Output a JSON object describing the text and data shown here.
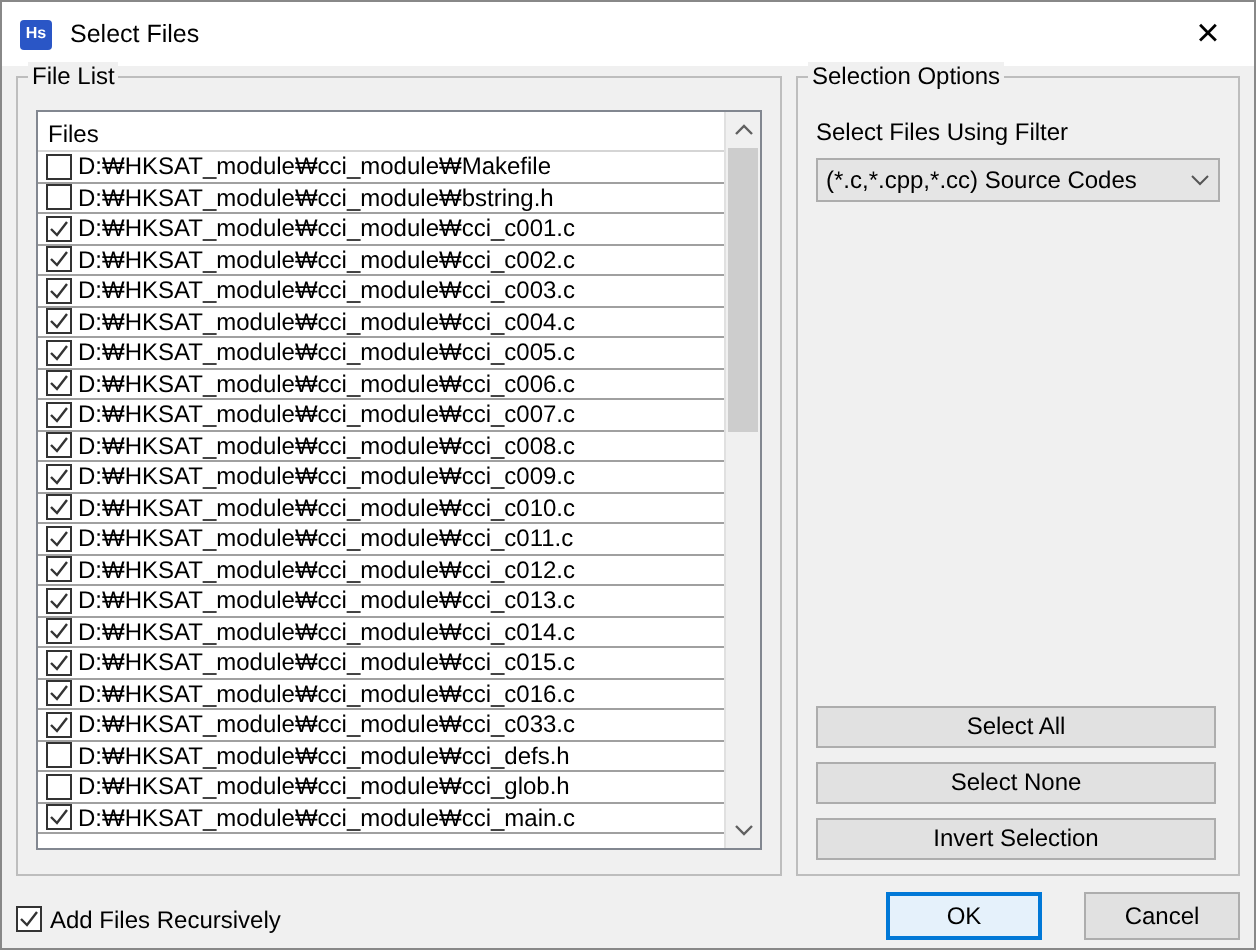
{
  "window": {
    "title": "Select Files",
    "icon_text": "Hs",
    "close": "×"
  },
  "file_list": {
    "title": "File List",
    "column": "Files",
    "rows": [
      {
        "path": "D:₩HKSAT_module₩cci_module₩Makefile",
        "checked": false
      },
      {
        "path": "D:₩HKSAT_module₩cci_module₩bstring.h",
        "checked": false
      },
      {
        "path": "D:₩HKSAT_module₩cci_module₩cci_c001.c",
        "checked": true
      },
      {
        "path": "D:₩HKSAT_module₩cci_module₩cci_c002.c",
        "checked": true
      },
      {
        "path": "D:₩HKSAT_module₩cci_module₩cci_c003.c",
        "checked": true
      },
      {
        "path": "D:₩HKSAT_module₩cci_module₩cci_c004.c",
        "checked": true
      },
      {
        "path": "D:₩HKSAT_module₩cci_module₩cci_c005.c",
        "checked": true
      },
      {
        "path": "D:₩HKSAT_module₩cci_module₩cci_c006.c",
        "checked": true
      },
      {
        "path": "D:₩HKSAT_module₩cci_module₩cci_c007.c",
        "checked": true
      },
      {
        "path": "D:₩HKSAT_module₩cci_module₩cci_c008.c",
        "checked": true
      },
      {
        "path": "D:₩HKSAT_module₩cci_module₩cci_c009.c",
        "checked": true
      },
      {
        "path": "D:₩HKSAT_module₩cci_module₩cci_c010.c",
        "checked": true
      },
      {
        "path": "D:₩HKSAT_module₩cci_module₩cci_c011.c",
        "checked": true
      },
      {
        "path": "D:₩HKSAT_module₩cci_module₩cci_c012.c",
        "checked": true
      },
      {
        "path": "D:₩HKSAT_module₩cci_module₩cci_c013.c",
        "checked": true
      },
      {
        "path": "D:₩HKSAT_module₩cci_module₩cci_c014.c",
        "checked": true
      },
      {
        "path": "D:₩HKSAT_module₩cci_module₩cci_c015.c",
        "checked": true
      },
      {
        "path": "D:₩HKSAT_module₩cci_module₩cci_c016.c",
        "checked": true
      },
      {
        "path": "D:₩HKSAT_module₩cci_module₩cci_c033.c",
        "checked": true
      },
      {
        "path": "D:₩HKSAT_module₩cci_module₩cci_defs.h",
        "checked": false
      },
      {
        "path": "D:₩HKSAT_module₩cci_module₩cci_glob.h",
        "checked": false
      },
      {
        "path": "D:₩HKSAT_module₩cci_module₩cci_main.c",
        "checked": true
      }
    ]
  },
  "selection_options": {
    "title": "Selection Options",
    "filter_label": "Select Files Using Filter",
    "filter_value": "(*.c,*.cpp,*.cc) Source Codes",
    "buttons": [
      "Select All",
      "Select None",
      "Invert Selection"
    ]
  },
  "recursive": {
    "label": "Add Files Recursively",
    "checked": true
  },
  "buttons": [
    {
      "label": "OK",
      "default": true
    },
    {
      "label": "Cancel",
      "default": false
    }
  ]
}
